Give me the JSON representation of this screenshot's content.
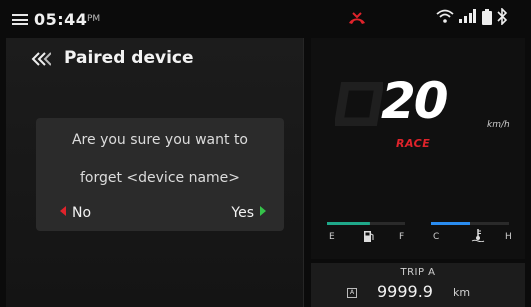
{
  "status_bar": {
    "time": "05:44",
    "ampm": "PM",
    "icons": [
      "menu-icon",
      "missed-call-icon",
      "wifi-icon",
      "signal-icon",
      "battery-icon",
      "bluetooth-icon"
    ]
  },
  "left_panel": {
    "title": "Paired device",
    "dialog": {
      "line1": "Are you sure you want to",
      "line2": "forget <device name>",
      "no_label": "No",
      "yes_label": "Yes"
    }
  },
  "speedometer": {
    "speed": "20",
    "unit": "km/h",
    "mode": "RACE",
    "fuel": {
      "empty_label": "E",
      "full_label": "F",
      "level": 0.55
    },
    "temperature": {
      "cold_label": "C",
      "hot_label": "H",
      "level": 0.5
    }
  },
  "trip": {
    "label": "TRIP A",
    "badge": "A",
    "value": "9999.9",
    "unit": "km"
  },
  "colors": {
    "accent_red": "#e0232b",
    "accent_green": "#35c24a",
    "fuel_teal": "#1fa88a",
    "temp_blue": "#2a8cf0"
  }
}
